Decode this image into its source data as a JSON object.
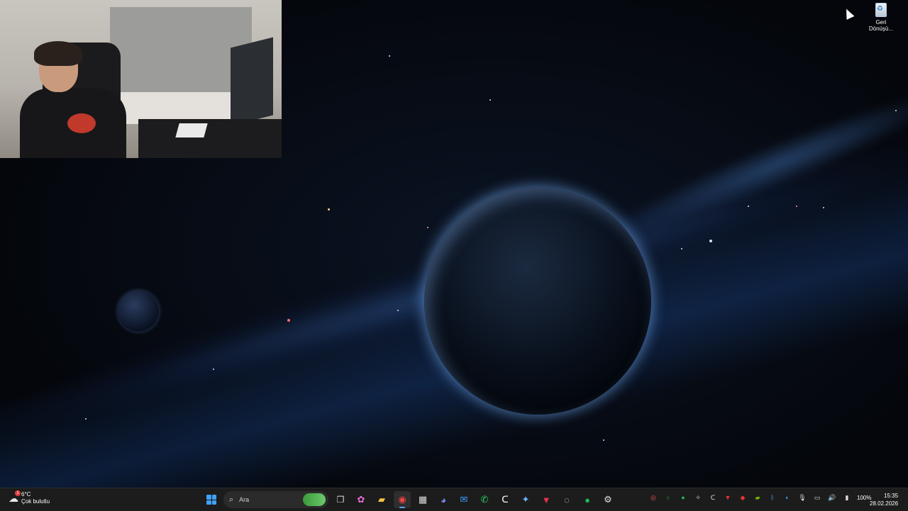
{
  "desktop": {
    "icons": [
      {
        "label_line1": "Geri",
        "label_line2": "Dönüşü..."
      }
    ]
  },
  "taskbar": {
    "weather": {
      "temperature": "6°C",
      "condition": "Çok bulutlu",
      "badge": "1"
    },
    "search": {
      "placeholder": "Ara"
    },
    "apps": [
      {
        "name": "file-explorer",
        "glyph": "📁"
      },
      {
        "name": "chrome",
        "glyph": "◉"
      },
      {
        "name": "store",
        "glyph": "▦"
      },
      {
        "name": "discord",
        "glyph": "◕"
      },
      {
        "name": "mail",
        "glyph": "✉"
      },
      {
        "name": "whatsapp",
        "glyph": "✆"
      },
      {
        "name": "capcut",
        "glyph": "ᑕ"
      },
      {
        "name": "app-blue",
        "glyph": "✦"
      },
      {
        "name": "app-red",
        "glyph": "▼"
      },
      {
        "name": "app-circle",
        "glyph": "◌"
      },
      {
        "name": "spotify",
        "glyph": "●"
      },
      {
        "name": "settings",
        "glyph": "⚙"
      }
    ],
    "tray": {
      "battery": "100%"
    },
    "clock": {
      "time": "15:35",
      "date": "28.02.2026"
    }
  },
  "colors": {
    "taskbar_bg": "#1c1c1c",
    "accent": "#3ea2ff",
    "spotify": "#1db954",
    "whatsapp": "#25d366"
  }
}
